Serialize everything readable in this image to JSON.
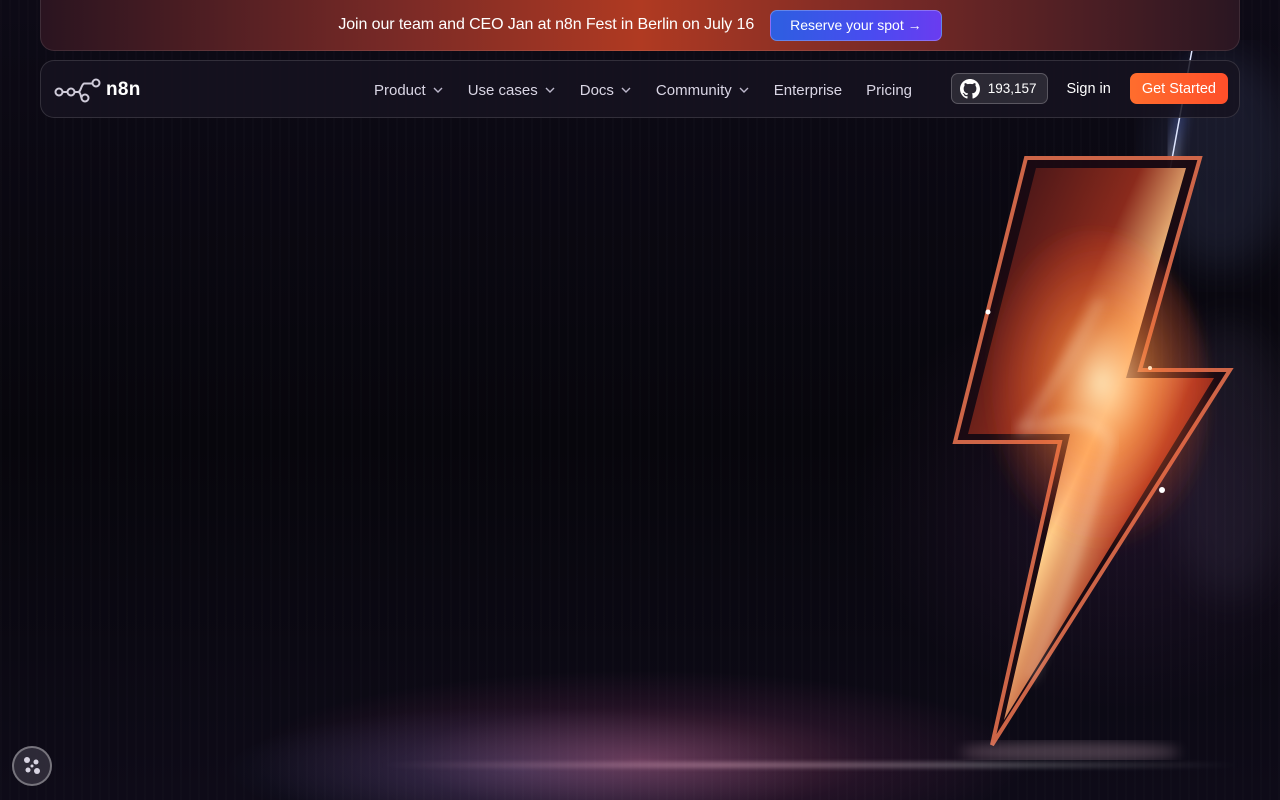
{
  "banner": {
    "text": "Join our team and CEO Jan at n8n Fest in Berlin on July 16",
    "button_label": "Reserve your spot →"
  },
  "nav": {
    "logo_text": "n8n",
    "logo_icon": "workflow-nodes-icon",
    "items": [
      {
        "label": "Product",
        "has_dropdown": true
      },
      {
        "label": "Use cases",
        "has_dropdown": true
      },
      {
        "label": "Docs",
        "has_dropdown": true
      },
      {
        "label": "Community",
        "has_dropdown": true
      },
      {
        "label": "Enterprise",
        "has_dropdown": false
      },
      {
        "label": "Pricing",
        "has_dropdown": false
      }
    ],
    "github": {
      "icon": "github-icon",
      "stars": "193,157"
    },
    "signin_label": "Sign in",
    "cta_label": "Get Started"
  },
  "hero": {
    "graphic": "lightning-bolt-illustration"
  },
  "cookie_button": {
    "icon": "cookie-icon"
  },
  "colors": {
    "background": "#0e0b18",
    "cta": "#ff5a2b",
    "banner_button": "#4a4bf0",
    "bolt_core": "#ffd9a0"
  }
}
